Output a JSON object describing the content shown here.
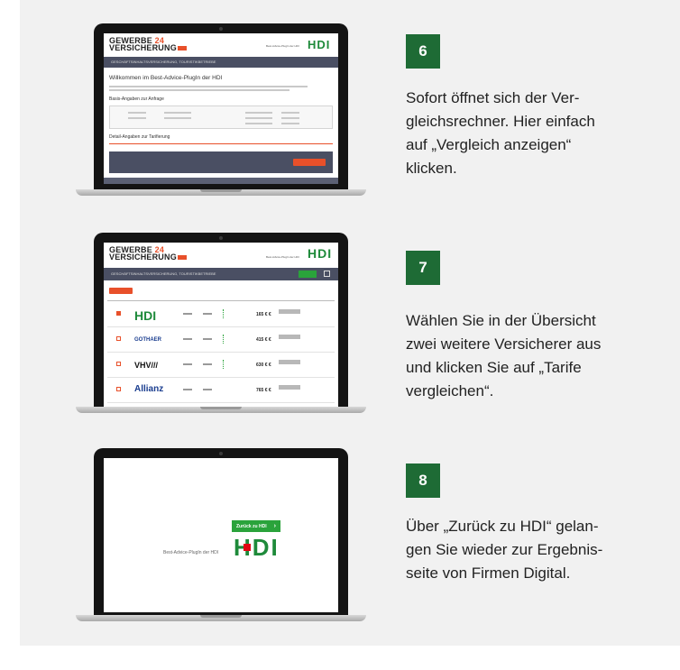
{
  "steps": [
    {
      "number": "6",
      "text": "Sofort öffnet sich der Ver-\ngleichsrechner. Hier einfach\nauf „Vergleich anzeigen“\nklicken.",
      "screen": {
        "logo_line1": "GEWERBE",
        "logo_num": "24",
        "logo_line2": "VERSICHERUNG",
        "hdi": "HDI",
        "nav": "GESCHÄFTSINHALTSVERSICHERUNG, TOURISTIKBETRIEBE",
        "title": "Willkommen im Best-Advice-PlugIn der HDI",
        "basis": "Basis-Angaben zur Anfrage",
        "detail": "Detail-Angaben zur Tarifierung"
      }
    },
    {
      "number": "7",
      "text": "Wählen Sie in der Übersicht\nzwei weitere Versicherer aus\nund klicken Sie auf „Tarife\nvergleichen“.",
      "screen": {
        "logo_line1": "GEWERBE",
        "logo_num": "24",
        "logo_line2": "VERSICHERUNG",
        "hdi": "HDI",
        "nav": "GESCHÄFTSINHALTSVERSICHERUNG, TOURISTIKBETRIEBE",
        "rows": [
          {
            "logo": "HDI",
            "color": "#1e8a3a",
            "price": "165 € €"
          },
          {
            "logo": "GOTHAER",
            "color": "#1a3d8f",
            "price": "415 € €"
          },
          {
            "logo": "VHV///",
            "color": "#111111",
            "price": "630 € €"
          },
          {
            "logo": "Allianz",
            "color": "#1a3d8f",
            "price": "765 € €"
          }
        ]
      }
    },
    {
      "number": "8",
      "text": "Über „Zurück zu HDI“ gelan-\ngen Sie wieder zur Ergebnis-\nseite von Firmen Digital.",
      "screen": {
        "back_button": "Zurück zu HDI",
        "back_arrow": "›",
        "plugin_label": "Best-Advice-PlugIn der HDI",
        "hdi": "HDI"
      }
    }
  ],
  "colors": {
    "badge": "#1e6b35",
    "hdi_green": "#1e8a3a",
    "hdi_red": "#e30613",
    "gewerbe_orange": "#e8502a",
    "nav_bar": "#4a4f63"
  }
}
